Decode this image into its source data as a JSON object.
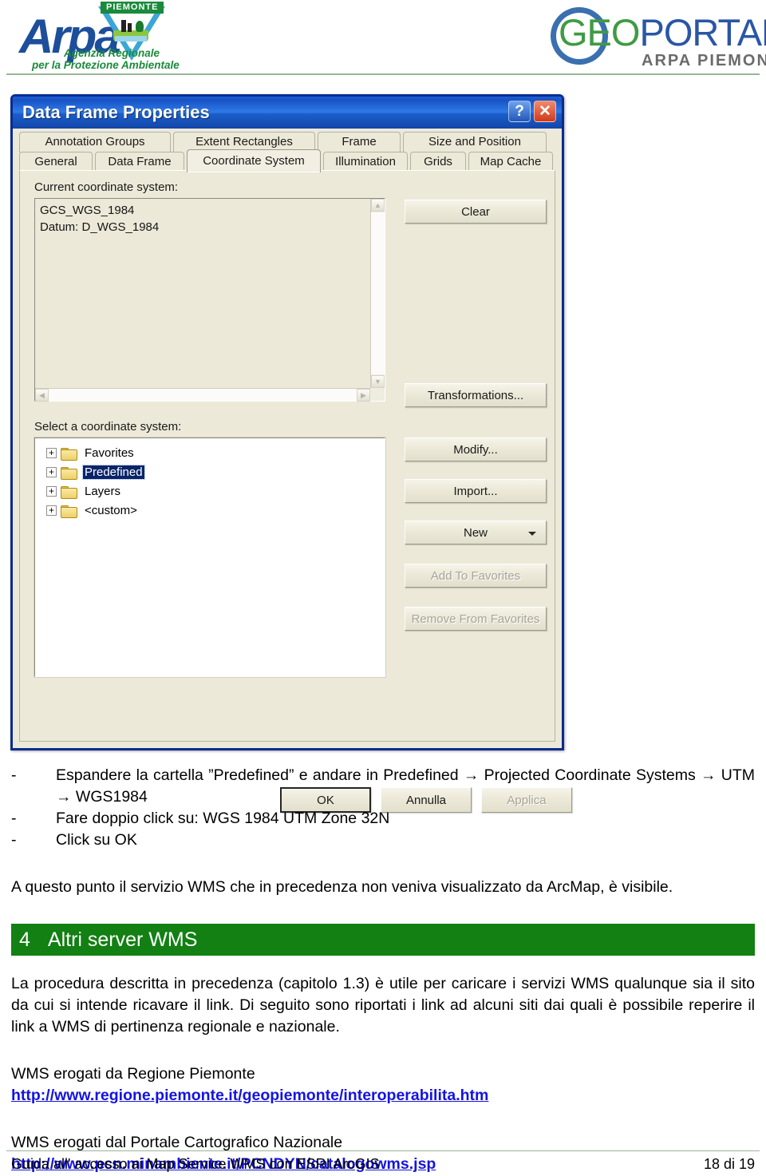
{
  "header": {
    "arpa_logo": {
      "wordmark": "Arpa",
      "region_banner": "PIEMONTE",
      "subtitle_line1": "Agenzia Regionale",
      "subtitle_line2": "per la Protezione Ambientale"
    },
    "geoportale_logo": {
      "text_part1": "GEO",
      "text_part2": "PORTALE",
      "subtitle": "ARPA PIEMONTE",
      "color_green": "#3f9b43",
      "color_blue": "#2a56a5",
      "color_gray": "#6b6b6b"
    }
  },
  "dialog": {
    "title": "Data Frame Properties",
    "help_button": "?",
    "close_button": "✕",
    "tabs_row1": [
      {
        "label": "Annotation Groups",
        "active": false
      },
      {
        "label": "Extent Rectangles",
        "active": false
      },
      {
        "label": "Frame",
        "active": false
      },
      {
        "label": "Size and Position",
        "active": false
      }
    ],
    "tabs_row2": [
      {
        "label": "General",
        "active": false
      },
      {
        "label": "Data Frame",
        "active": false
      },
      {
        "label": "Coordinate System",
        "active": true
      },
      {
        "label": "Illumination",
        "active": false
      },
      {
        "label": "Grids",
        "active": false
      },
      {
        "label": "Map Cache",
        "active": false
      }
    ],
    "current_cs_label": "Current coordinate system:",
    "current_cs_value": "GCS_WGS_1984\nDatum: D_WGS_1984",
    "select_cs_label": "Select a coordinate system:",
    "tree_items": [
      {
        "label": "Favorites",
        "selected": false,
        "expander": "+"
      },
      {
        "label": "Predefined",
        "selected": true,
        "expander": "+"
      },
      {
        "label": "Layers",
        "selected": false,
        "expander": "+"
      },
      {
        "label": "<custom>",
        "selected": false,
        "expander": "+"
      }
    ],
    "buttons": {
      "clear": "Clear",
      "transformations": "Transformations...",
      "modify": "Modify...",
      "import": "Import...",
      "new": "New",
      "add_to_favorites": "Add To Favorites",
      "remove_from_favorites": "Remove From Favorites",
      "ok": "OK",
      "cancel": "Annulla",
      "apply": "Applica"
    }
  },
  "body": {
    "bullet1_dash": "-",
    "bullet1_text": "Espandere la cartella ”Predefined” e andare in Predefined → Projected Coordinate Systems → UTM → WGS1984",
    "bullet2_dash": "-",
    "bullet2_text": "Fare doppio click su: WGS 1984 UTM Zone 32N",
    "bullet3_dash": "-",
    "bullet3_text": "Click su OK",
    "paragraph_intro": "A questo punto il servizio WMS che in precedenza non veniva visualizzato da ArcMap, è visibile.",
    "section_number": "4",
    "section_title": "Altri server WMS",
    "section_color": "#128012",
    "paragraph_main": "La procedura descritta in precedenza (capitolo 1.3) è utile per caricare i servizi WMS qualunque sia il sito da cui si intende ricavare il link. Di seguito sono riportati i link ad alcuni siti dai quali è possibile reperire il link a WMS di pertinenza regionale e nazionale.",
    "wms_regione_label": "WMS erogati da Regione Piemonte",
    "wms_regione_link": "http://www.regione.piemonte.it/geopiemonte/interoperabilita.htm",
    "wms_pcn_label": "WMS erogati dal Portale Cartografico Nazionale",
    "wms_pcn_link": "http://www.pcn.minambiente.it/PCNDYN/catalogowms.jsp",
    "link_color": "#1414e0"
  },
  "footer": {
    "left_text": "Guida all' accesso ai Map Service WMS con ESRI ArcGIS",
    "right_text": "18 di 19"
  }
}
